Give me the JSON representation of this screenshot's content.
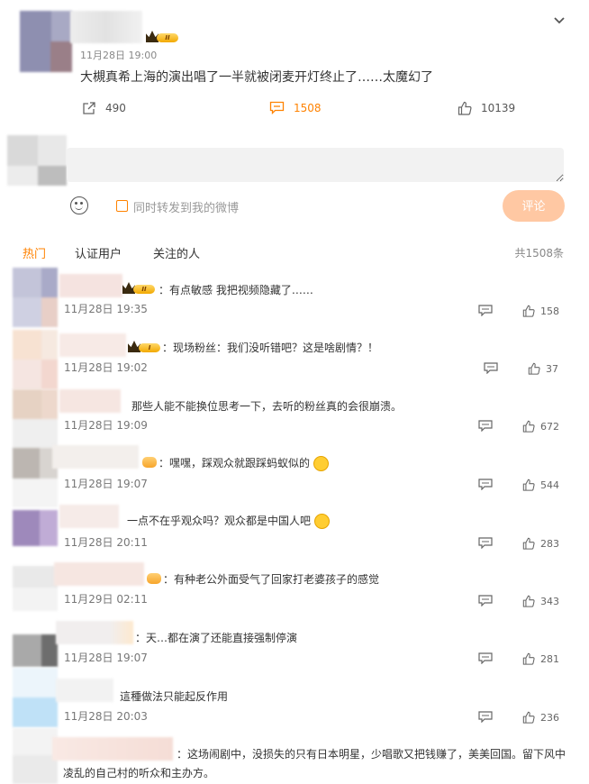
{
  "post": {
    "time": "11月28日 19:00",
    "text": "大槻真希上海的演出唱了一半就被闭麦开灯终止了……太魔幻了",
    "level": "II",
    "reposts": "490",
    "comments": "1508",
    "likes": "10139",
    "icons": [
      "repost-icon",
      "comment-icon",
      "like-icon",
      "chevron-down-icon"
    ]
  },
  "composer": {
    "placeholder": "",
    "repost_label": "同时转发到我的微博",
    "submit_label": "评论"
  },
  "tabs": [
    {
      "label": "热门",
      "active": true
    },
    {
      "label": "认证用户",
      "active": false
    },
    {
      "label": "关注的人",
      "active": false
    }
  ],
  "total_label": "共1508条",
  "comments": [
    {
      "text": "：有点敏感 我把视频隐藏了……",
      "time": "11月28日 19:35",
      "likes": "158"
    },
    {
      "text": "：现场粉丝：我们没听错吧？这是啥剧情？！",
      "time": "11月28日 19:02",
      "likes": "37"
    },
    {
      "text": "那些人能不能换位思考一下，去听的粉丝真的会很崩溃。",
      "time": "11月28日 19:09",
      "likes": "672"
    },
    {
      "text": "：嘿嘿，踩观众就跟踩蚂蚁似的",
      "time": "11月28日 19:07",
      "likes": "544"
    },
    {
      "text": "一点不在乎观众吗？观众都是中国人吧",
      "time": "11月28日 20:11",
      "likes": "283"
    },
    {
      "text": "：有种老公外面受气了回家打老婆孩子的感觉",
      "time": "11月29日 02:11",
      "likes": "343"
    },
    {
      "text": "：天…都在演了还能直接强制停演",
      "time": "11月28日 19:07",
      "likes": "281"
    },
    {
      "text": "這種做法只能起反作用",
      "time": "11月28日 20:03",
      "likes": "236"
    },
    {
      "text": "：这场闹剧中，没损失的只有日本明星，少唱歌又把钱赚了，美美回国。留下风中",
      "text2": "凌乱的自己村的听众和主办方。",
      "time": "",
      "likes": ""
    }
  ]
}
